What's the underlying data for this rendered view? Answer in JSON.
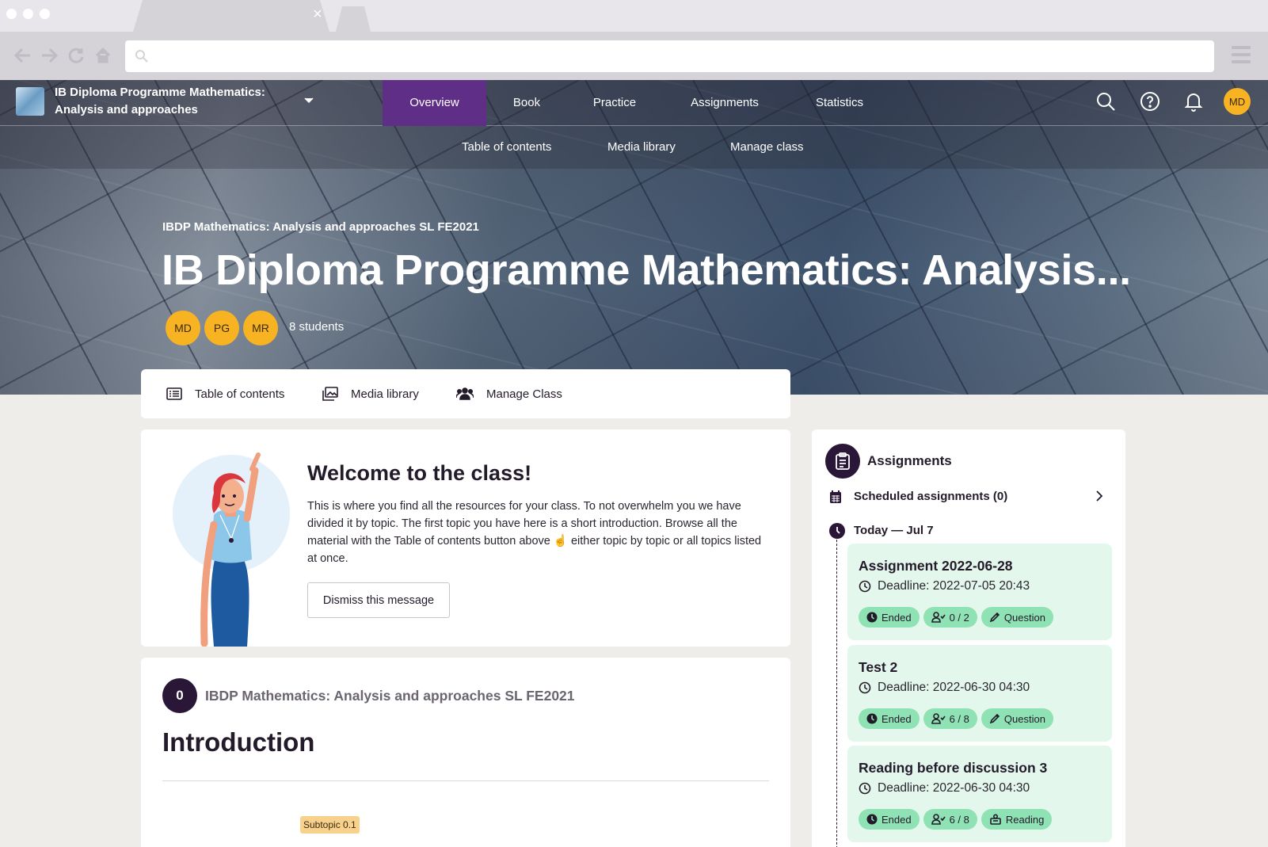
{
  "browser": {
    "url": ""
  },
  "app": {
    "course_title": "IB Diploma Programme Mathematics: Analysis and approaches",
    "nav_tabs": [
      {
        "label": "Overview",
        "active": true
      },
      {
        "label": "Book"
      },
      {
        "label": "Practice"
      },
      {
        "label": "Assignments"
      },
      {
        "label": "Statistics"
      }
    ],
    "sub_tabs": [
      "Table of contents",
      "Media library",
      "Manage class"
    ],
    "user_initials": "MD",
    "accent_color": "#5f2e86",
    "avatar_color": "#f7b322"
  },
  "hero": {
    "kicker": "IBDP Mathematics: Analysis and approaches SL FE2021",
    "title": "IB Diploma Programme Mathematics: Analysis...",
    "members": [
      "MD",
      "PG",
      "MR"
    ],
    "students_label": "8 students"
  },
  "quick_links": [
    "Table of contents",
    "Media library",
    "Manage Class"
  ],
  "welcome": {
    "title": "Welcome to the class!",
    "body": "This is where you find all the resources for your class. To not overwhelm you we have divided it by topic. The first topic you have here is a short introduction. Browse all the material with the Table of contents button above ☝ either topic by topic or all topics listed at once.",
    "dismiss_label": "Dismiss this message"
  },
  "topic": {
    "number": "0",
    "course": "IBDP Mathematics: Analysis and approaches SL FE2021",
    "title": "Introduction",
    "subtopic_badge": "Subtopic 0.1"
  },
  "assignments": {
    "title": "Assignments",
    "scheduled_label": "Scheduled assignments (0)",
    "today_label": "Today — Jul 7",
    "items": [
      {
        "title": "Assignment 2022-06-28",
        "deadline": "Deadline: 2022-07-05 20:43",
        "status": "Ended",
        "submissions": "0 / 2",
        "type": "Question",
        "type_icon": "pencil-icon"
      },
      {
        "title": "Test 2",
        "deadline": "Deadline: 2022-06-30 04:30",
        "status": "Ended",
        "submissions": "6 / 8",
        "type": "Question",
        "type_icon": "pencil-icon"
      },
      {
        "title": "Reading before discussion 3",
        "deadline": "Deadline: 2022-06-30 04:30",
        "status": "Ended",
        "submissions": "6 / 8",
        "type": "Reading",
        "type_icon": "reading-icon"
      }
    ],
    "card_color": "#e3f7ec",
    "pill_color": "#8fe2b4"
  }
}
